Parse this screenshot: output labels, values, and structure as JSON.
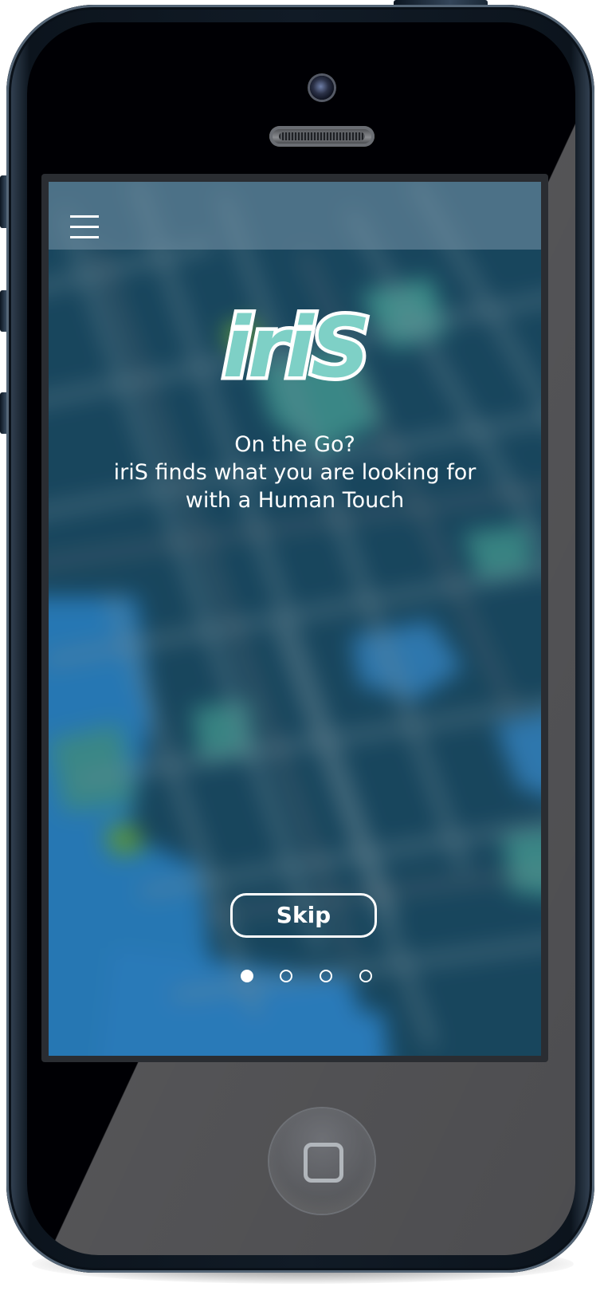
{
  "app": {
    "logo_text": "iriS",
    "brand_color": "#7ed0c6"
  },
  "header": {
    "menu_icon": "hamburger-menu-icon"
  },
  "onboarding": {
    "tagline_lines": [
      "On the Go?",
      "iriS finds what you are looking for",
      "with a Human Touch"
    ],
    "skip_label": "Skip",
    "page_indicator": {
      "total": 4,
      "current": 1
    }
  },
  "colors": {
    "screen_bg": "#1c4a61",
    "topbar": "#7896aa",
    "text": "#ffffff"
  }
}
